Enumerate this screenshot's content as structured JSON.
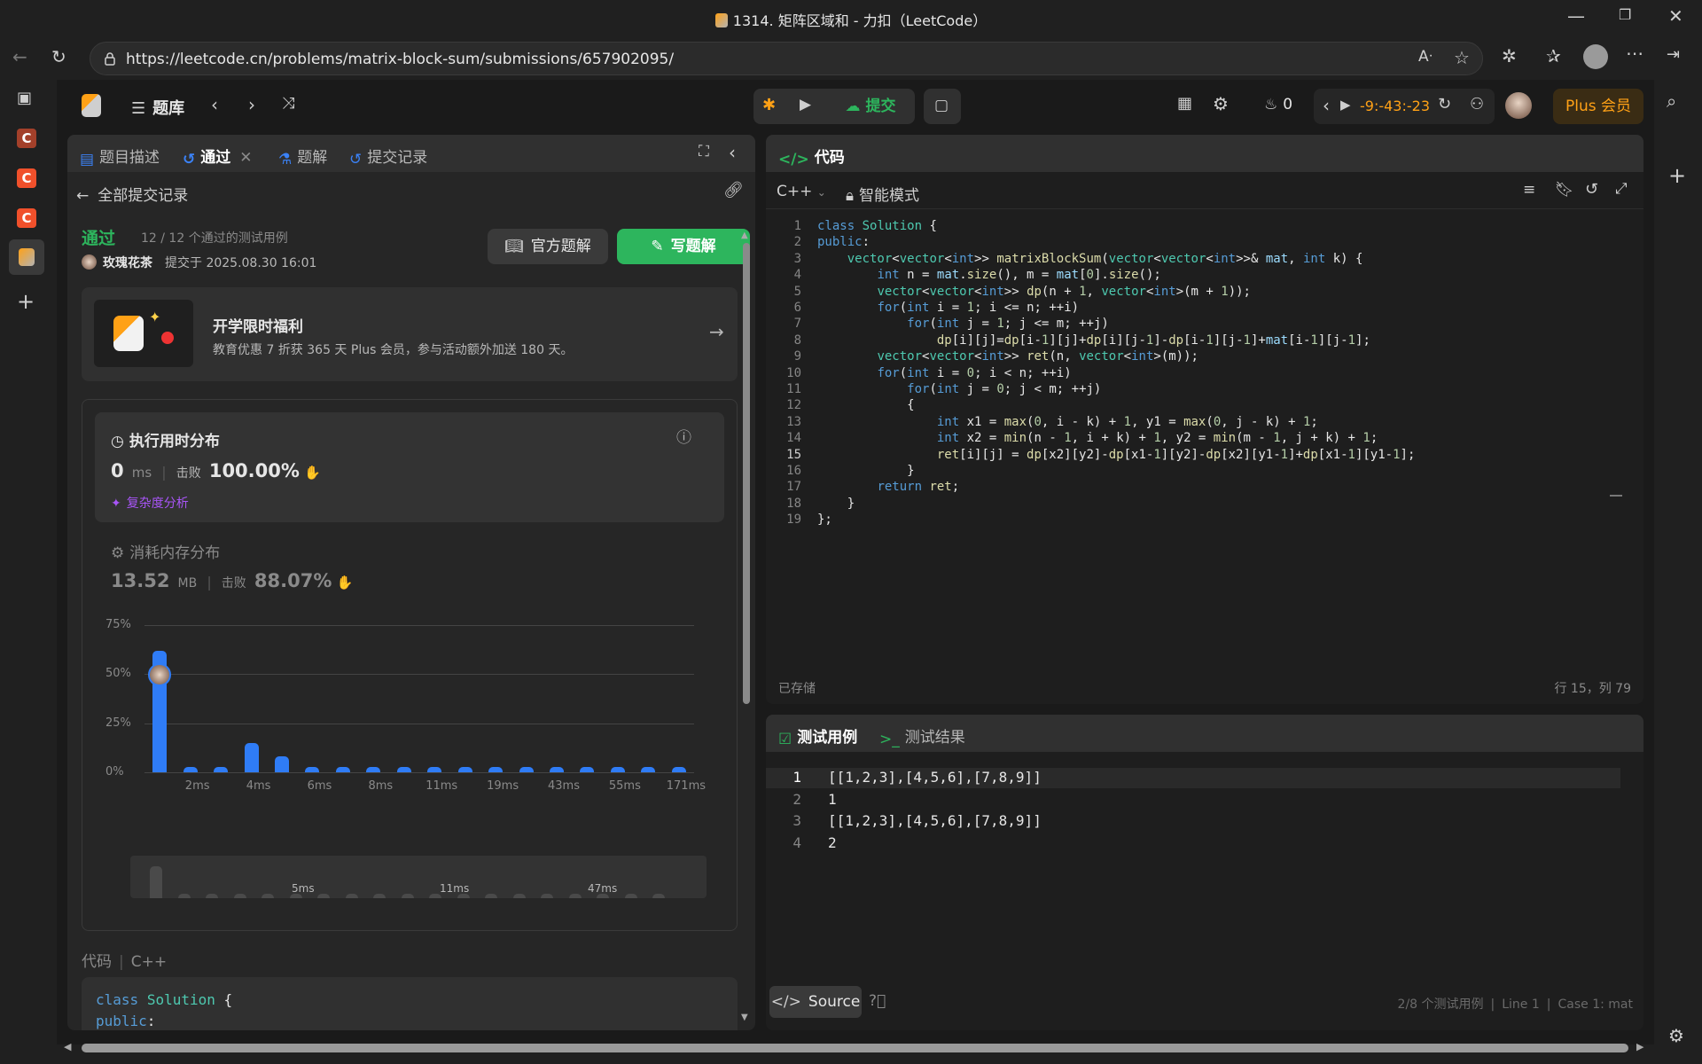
{
  "browser": {
    "title": "1314. 矩阵区域和 - 力扣（LeetCode）",
    "url": "https://leetcode.cn/problems/matrix-block-sum/submissions/657902095/"
  },
  "navbar": {
    "problem_list": "题库",
    "submit": "提交",
    "fire_count": "0",
    "timer": "-9:-43:-23",
    "plus": "Plus 会员"
  },
  "left": {
    "tabs": [
      "题目描述",
      "通过",
      "题解",
      "提交记录"
    ],
    "back": "全部提交记录",
    "status": "通过",
    "passed": "12 / 12 个通过的测试用例",
    "user": "玫瑰花茶",
    "submitted": "提交于 2025.08.30 16:01",
    "official_btn": "官方题解",
    "write_btn": "写题解",
    "promo_title": "开学限时福利",
    "promo_text": "教育优惠 7 折获 365 天 Plus 会员，参与活动额外加送 180 天。",
    "runtime_title": "执行用时分布",
    "runtime_value": "0",
    "runtime_unit": "ms",
    "beat_label": "击败",
    "runtime_beat": "100.00%",
    "complexity": "复杂度分析",
    "memory_title": "消耗内存分布",
    "memory_value": "13.52",
    "memory_unit": "MB",
    "memory_beat": "88.07%",
    "code_label": "代码",
    "code_lang": "C++",
    "code_preview": [
      "class Solution {",
      "public:"
    ]
  },
  "chart_data": {
    "type": "bar",
    "ylim": [
      0,
      75
    ],
    "yticks": [
      "75%",
      "50%",
      "25%",
      "0%"
    ],
    "xticks": [
      "2ms",
      "4ms",
      "6ms",
      "8ms",
      "11ms",
      "19ms",
      "43ms",
      "55ms",
      "171ms"
    ],
    "values": [
      62,
      2,
      2,
      15,
      8,
      2,
      2,
      2,
      2,
      2,
      2,
      2,
      2,
      2,
      2,
      2,
      2,
      2
    ],
    "mini_ticks": [
      "5ms",
      "11ms",
      "47ms"
    ]
  },
  "editor": {
    "title": "代码",
    "lang": "C++",
    "mode": "智能模式",
    "saved": "已存储",
    "cursor": "行 15，列 79",
    "lines": [
      "class Solution {",
      "public:",
      "    vector<vector<int>> matrixBlockSum(vector<vector<int>>& mat, int k) {",
      "        int n = mat.size(), m = mat[0].size();",
      "        vector<vector<int>> dp(n + 1, vector<int>(m + 1));",
      "        for(int i = 1; i <= n; ++i)",
      "            for(int j = 1; j <= m; ++j)",
      "                dp[i][j]=dp[i-1][j]+dp[i][j-1]-dp[i-1][j-1]+mat[i-1][j-1];",
      "        vector<vector<int>> ret(n, vector<int>(m));",
      "        for(int i = 0; i < n; ++i)",
      "            for(int j = 0; j < m; ++j)",
      "            {",
      "                int x1 = max(0, i - k) + 1, y1 = max(0, j - k) + 1;",
      "                int x2 = min(n - 1, i + k) + 1, y2 = min(m - 1, j + k) + 1;",
      "                ret[i][j] = dp[x2][y2]-dp[x1-1][y2]-dp[x2][y1-1]+dp[x1-1][y1-1];",
      "            }",
      "        return ret;",
      "    }",
      "};"
    ]
  },
  "testcase": {
    "tabs": [
      "测试用例",
      "测试结果"
    ],
    "lines": [
      "[[1,2,3],[4,5,6],[7,8,9]]",
      "1",
      "[[1,2,3],[4,5,6],[7,8,9]]",
      "2"
    ],
    "source": "Source",
    "count": "2/8 个测试用例",
    "line": "Line 1",
    "case": "Case 1: mat"
  },
  "colors": {
    "accent": "#2db55d",
    "bar": "#2f7cf6",
    "plus": "#ffa116"
  }
}
